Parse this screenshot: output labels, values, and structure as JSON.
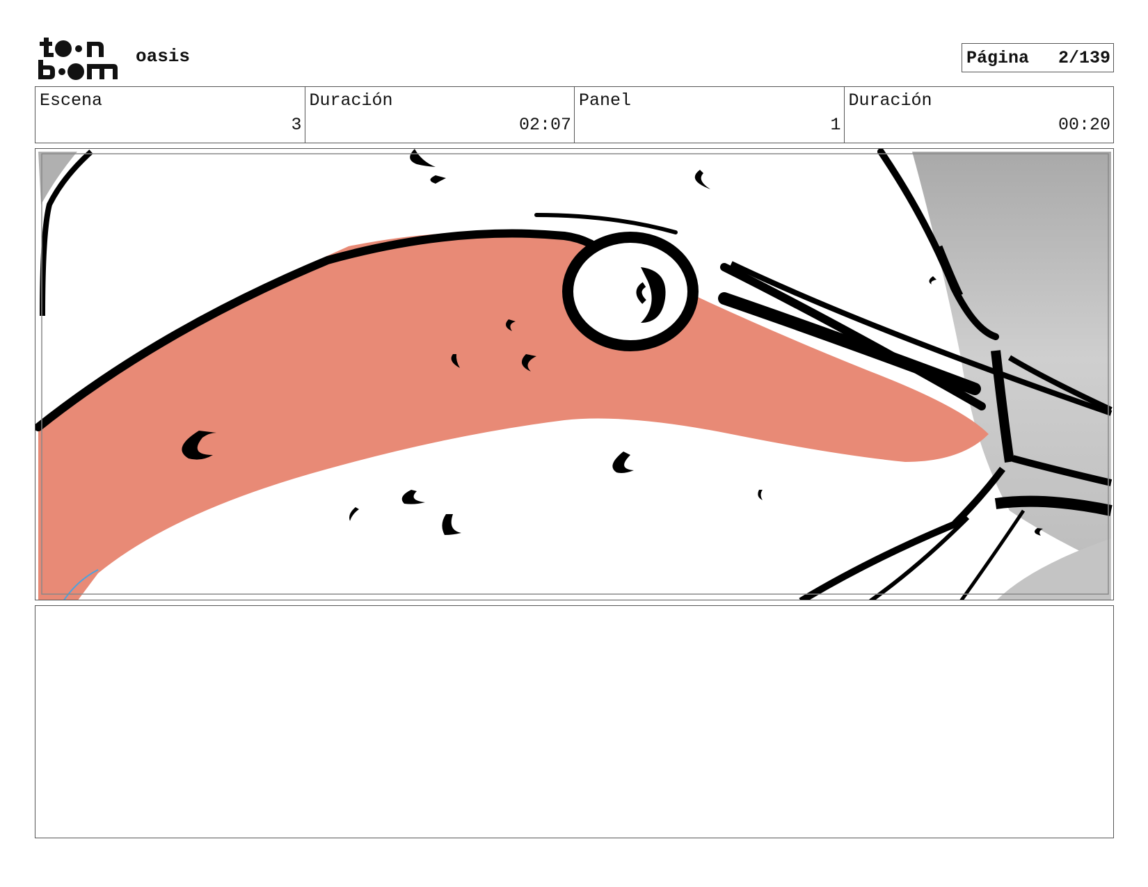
{
  "header": {
    "project_title": "oasis",
    "page_label": "Página",
    "page_value": "2/139"
  },
  "info": [
    {
      "label": "Escena",
      "value": "3"
    },
    {
      "label": "Duración",
      "value": "02:07"
    },
    {
      "label": "Panel",
      "value": "1"
    },
    {
      "label": "Duración",
      "value": "00:20"
    }
  ],
  "panel": {
    "colors": {
      "flesh": "#e88a76",
      "ink": "#000000",
      "sky": "#b8b8b8"
    }
  },
  "notes": {}
}
